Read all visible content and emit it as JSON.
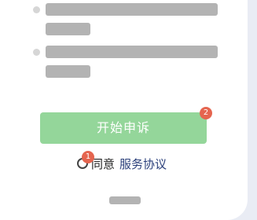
{
  "colors": {
    "page_background": "#e9ecf4",
    "card_background": "#ffffff",
    "placeholder_gray": "#b3b3b3",
    "button_green": "#94d69a",
    "badge_red": "#e5654f",
    "link_blue": "#2a3f7a"
  },
  "form": {
    "start_button_label": "开始申诉",
    "start_button_badge": "2",
    "agree_badge": "1",
    "agree_label": "同意",
    "agreement_link": "服务协议"
  }
}
